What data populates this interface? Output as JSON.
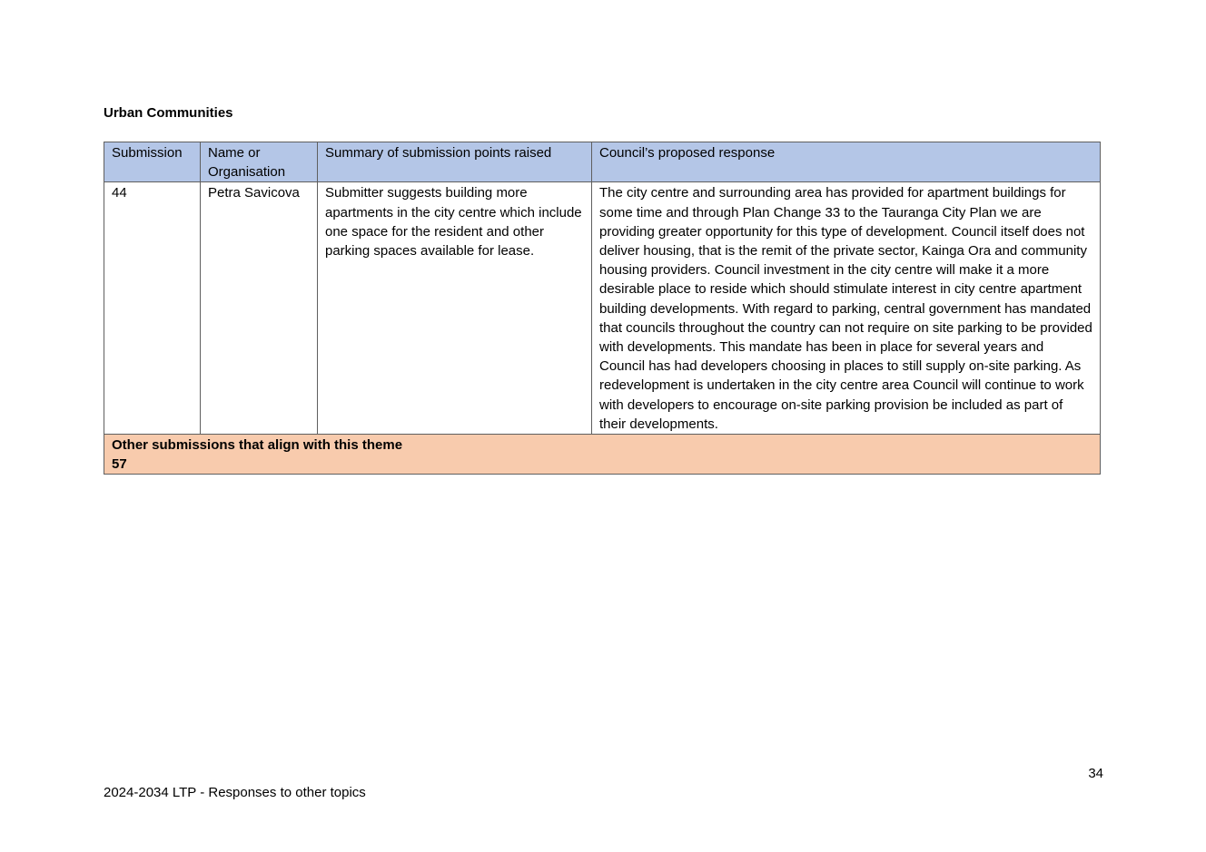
{
  "section_title": "Urban Communities",
  "table": {
    "headers": [
      "Submission",
      "Name or Organisation",
      "Summary of submission points raised",
      "Council’s proposed response"
    ],
    "rows": [
      {
        "submission": "44",
        "name": "Petra Savicova",
        "summary": "Submitter suggests building more apartments in the city centre which include one space for the resident and other parking spaces available for lease.",
        "response": "The city centre and surrounding area has provided for apartment buildings for some time and through Plan Change 33 to the Tauranga City Plan we are providing greater opportunity for this type of development.  Council itself does not deliver housing, that is the remit of the private sector, Kainga Ora and community housing providers.  Council investment in the city centre will make it a more desirable place to reside which should stimulate interest in city centre apartment building developments. With regard to parking, central government has mandated that councils throughout the country can not require on site parking to be provided with developments. This mandate has been in place for several years and Council has had developers choosing in places to still supply on-site parking. As redevelopment is undertaken in the city centre area Council will continue to work with developers to encourage on-site parking provision be included as part of their developments."
      }
    ],
    "footer_label": "Other submissions that align with this theme",
    "footer_value": "57"
  },
  "colors": {
    "header_bg": "#b4c6e7",
    "footer_bg": "#f8cbad",
    "border": "#5f5f5f"
  },
  "page_number": "34",
  "document_footer": "2024-2034 LTP - Responses to other topics"
}
